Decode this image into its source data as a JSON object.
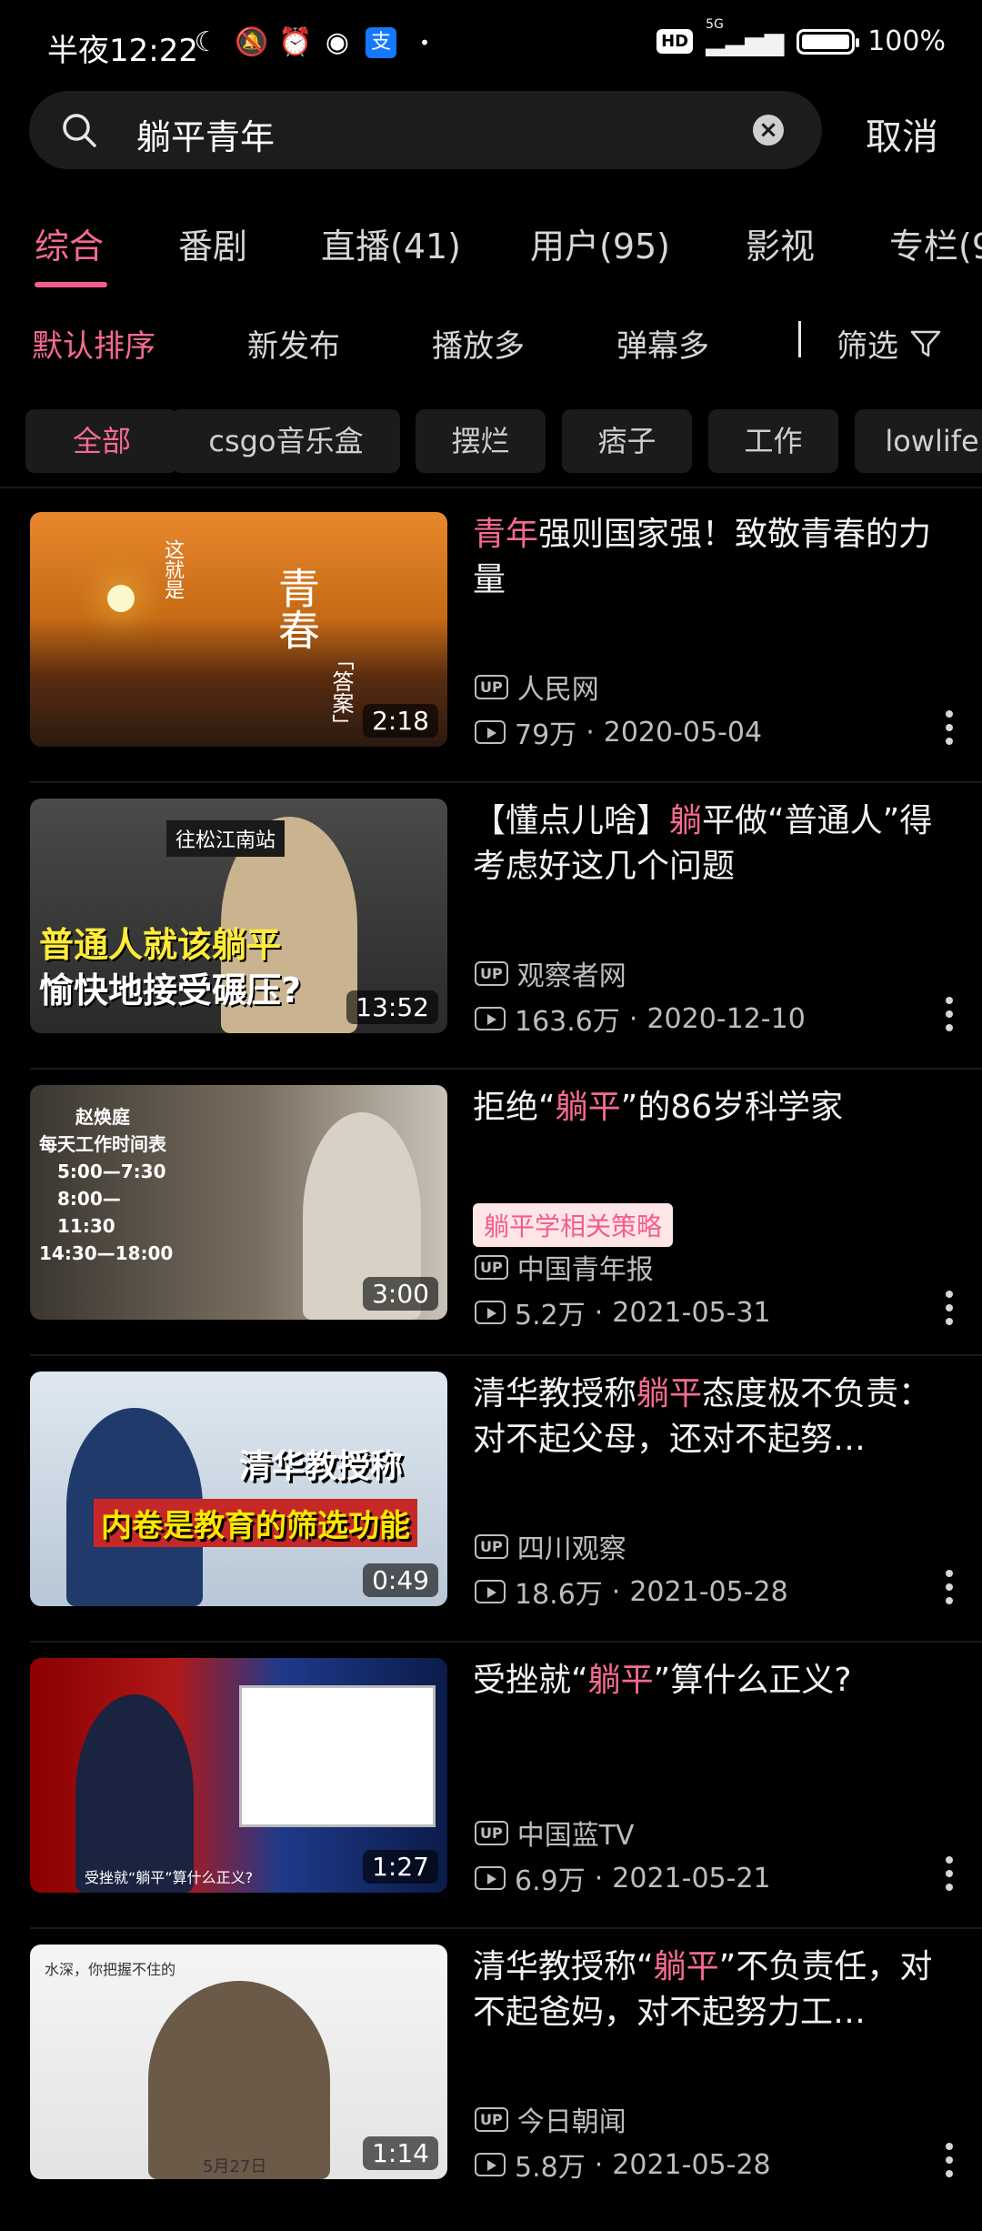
{
  "status_bar": {
    "time": "半夜12:22",
    "network_label": "5G",
    "hd_label": "HD",
    "battery_text": "100%",
    "battery_level": 1.0
  },
  "search": {
    "query": "躺平青年",
    "cancel_label": "取消"
  },
  "tabs": [
    {
      "label": "综合",
      "active": true
    },
    {
      "label": "番剧"
    },
    {
      "label": "直播(41)"
    },
    {
      "label": "用户(95)"
    },
    {
      "label": "影视"
    },
    {
      "label": "专栏(9"
    }
  ],
  "sort": {
    "default": "默认排序",
    "newest": "新发布",
    "most_played": "播放多",
    "most_danmaku": "弹幕多",
    "filter_label": "筛选"
  },
  "chips": [
    "全部",
    "csgo音乐盒",
    "摆烂",
    "痞子",
    "工作",
    "lowlife"
  ],
  "videos": [
    {
      "title_hl": "青年",
      "title_rest": "强则国家强！致敬青春的力量",
      "thumb_text": [
        "这就是",
        "青春",
        "「答案」"
      ],
      "duration": "2:18",
      "uploader": "人民网",
      "views": "79万",
      "date": "2020-05-04"
    },
    {
      "title_pre": "【懂点儿啥】",
      "title_hl": "躺",
      "title_rest": "平做“普通人”得考虑好这几个问题",
      "thumb_text": [
        "往松江南站",
        "普通人就该躺平",
        "愉快地接受碾压?"
      ],
      "duration": "13:52",
      "uploader": "观察者网",
      "views": "163.6万",
      "date": "2020-12-10"
    },
    {
      "title_pre": "拒绝“",
      "title_hl": "躺平",
      "title_rest": "”的86岁科学家",
      "tag": "躺平学相关策略",
      "thumb_text": [
        "赵焕庭",
        "每天工作时间表",
        "5:00—7:30",
        "8:00—11:30",
        "14:30—18:00"
      ],
      "duration": "3:00",
      "uploader": "中国青年报",
      "views": "5.2万",
      "date": "2021-05-31"
    },
    {
      "title_pre": "清华教授称",
      "title_hl": "躺平",
      "title_rest": "态度极不负责：对不起父母，还对不起努…",
      "thumb_text": [
        "清华教授称",
        "内卷是教育的筛选功能"
      ],
      "duration": "0:49",
      "uploader": "四川观察",
      "views": "18.6万",
      "date": "2021-05-28"
    },
    {
      "title_pre": "受挫就“",
      "title_hl": "躺平",
      "title_rest": "”算什么正义?",
      "thumb_text": [
        "受挫就“躺平”算什么正义?"
      ],
      "duration": "1:27",
      "uploader": "中国蓝TV",
      "views": "6.9万",
      "date": "2021-05-21"
    },
    {
      "title_pre": "清华教授称“",
      "title_hl": "躺平",
      "title_rest": "”不负责任，对不起爸妈，对不起努力工…",
      "thumb_text": [
        "水深，你把握不住的",
        "5月27日"
      ],
      "duration": "1:14",
      "uploader": "今日朝闻",
      "views": "5.8万",
      "date": "2021-05-28"
    }
  ],
  "colors": {
    "accent": "#f76b8f",
    "background": "#000000",
    "search_bg": "#1c1c1e",
    "chip_bg": "#1b1b1b"
  }
}
